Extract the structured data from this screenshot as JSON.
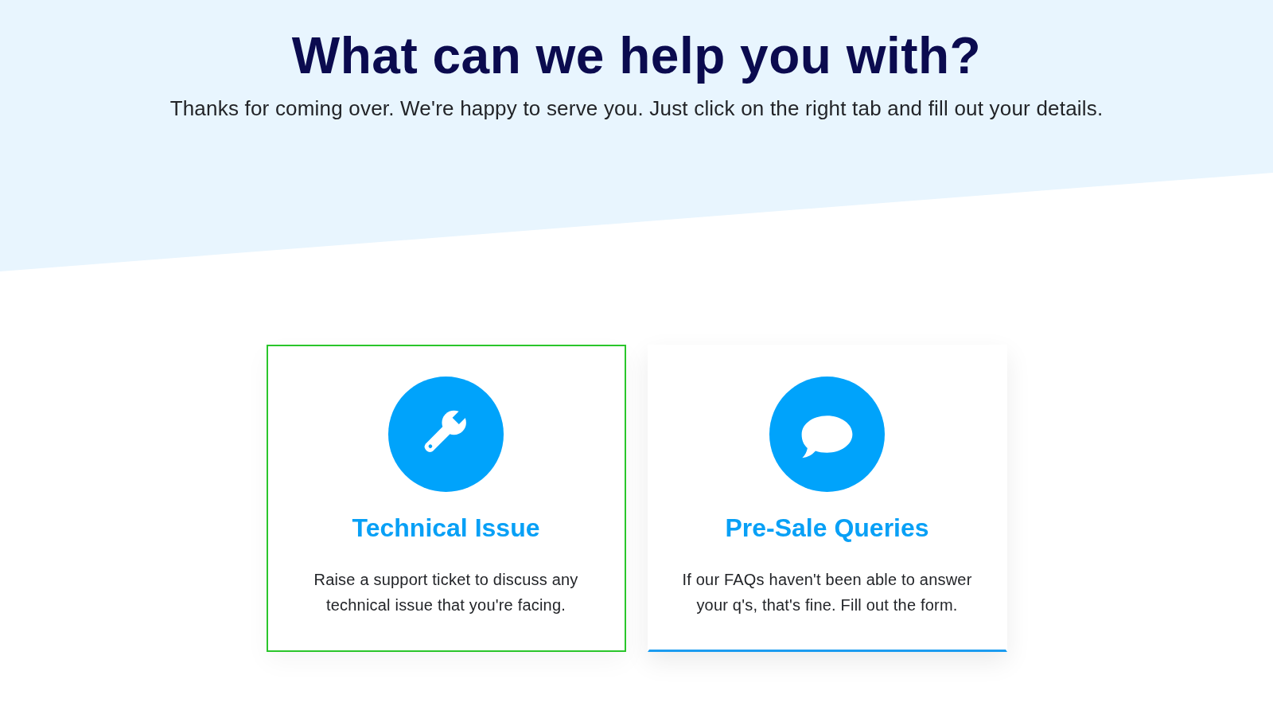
{
  "header": {
    "title": "What can we help you with?",
    "subtitle": "Thanks for coming over. We're happy to serve you. Just click on the right tab and fill out your details."
  },
  "options": [
    {
      "kind": "wrench",
      "title": "Technical Issue",
      "description": "Raise a support ticket to discuss any technical issue that you're facing.",
      "selected": true
    },
    {
      "kind": "speech-bubble",
      "title": "Pre-Sale Queries",
      "description": "If our FAQs haven't been able to answer your q's, that's fine. Fill out the form.",
      "selected": false
    }
  ]
}
